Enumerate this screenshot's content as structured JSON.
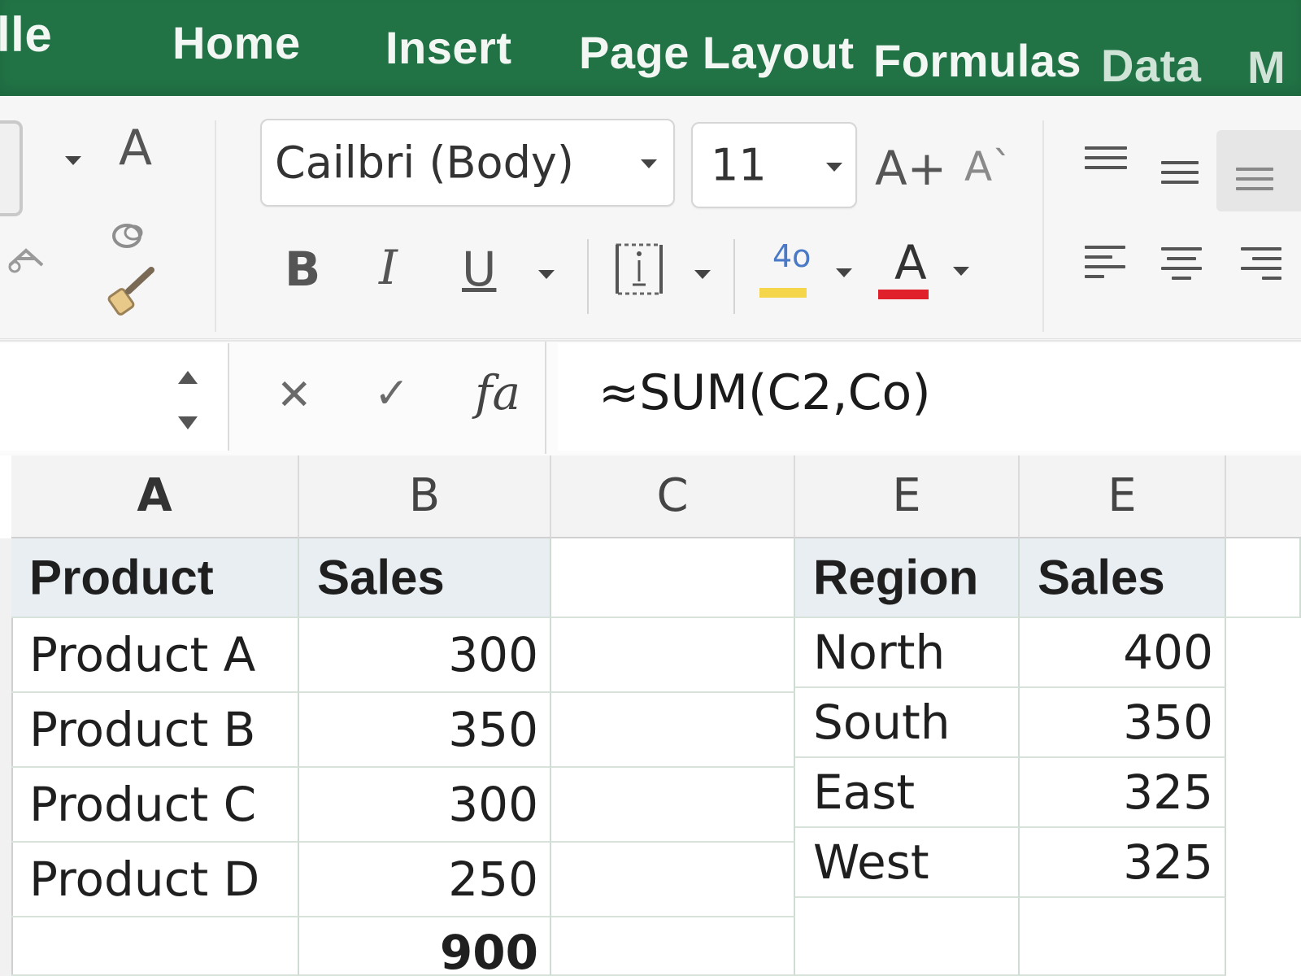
{
  "ribbon_tabs": {
    "file": "lle",
    "home": "Home",
    "insert": "Insert",
    "page_layout": "Page Layout",
    "formulas": "Formulas",
    "data": "Data",
    "more": "M"
  },
  "font_group": {
    "clipboard_letter": "A",
    "font_name": "Cailbri (Body)",
    "font_size": "11",
    "grow_font": "A+",
    "shrink_font": "A`",
    "bold": "B",
    "italic": "I",
    "underline": "U",
    "highlight_label": "4o",
    "highlight_color": "#f5d54a",
    "font_color_label": "A",
    "font_color": "#e0202a"
  },
  "formula_bar": {
    "cancel": "✕",
    "enter": "✓",
    "fx": "fa",
    "formula": "≈SUM(C2,Co)"
  },
  "columns": [
    "A",
    "B",
    "C",
    "E",
    "E"
  ],
  "table_left": {
    "headers": [
      "Product",
      "Sales"
    ],
    "rows": [
      [
        "Product A",
        "300"
      ],
      [
        "Product B",
        "350"
      ],
      [
        "Product C",
        "300"
      ],
      [
        "Product D",
        "250"
      ]
    ],
    "total": "900"
  },
  "table_right": {
    "headers": [
      "Region",
      "Sales"
    ],
    "rows": [
      [
        "North",
        "400"
      ],
      [
        "South",
        "350"
      ],
      [
        "East",
        "325"
      ],
      [
        "West",
        "325"
      ]
    ]
  },
  "colors": {
    "ribbon_green": "#217346",
    "header_fill": "#e8eef1"
  }
}
